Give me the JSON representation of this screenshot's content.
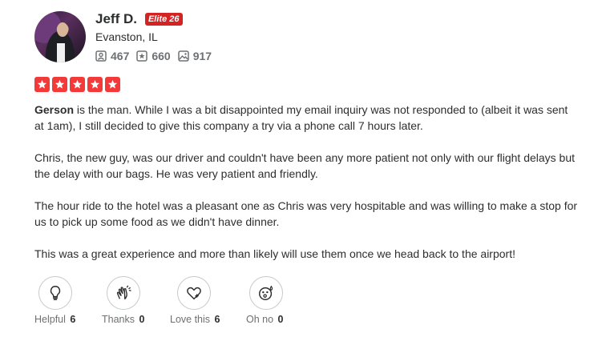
{
  "user": {
    "name": "Jeff D.",
    "elite_badge": "Elite 26",
    "location": "Evanston, IL",
    "stats": {
      "friends": "467",
      "reviews": "660",
      "photos": "917"
    }
  },
  "rating": {
    "stars": 5,
    "max": 5,
    "color": "#f43939"
  },
  "review": {
    "p1_bold": "Gerson",
    "p1_rest": " is the man. While I was a bit disappointed my email inquiry was not responded to (albeit it was sent at 1am), I still decided to give this company a try via a phone call 7 hours later.",
    "p2": "Chris, the new guy, was our driver and couldn't have been any more patient not only with our flight delays but the delay with our bags. He was very patient and friendly.",
    "p3": "The hour ride to the hotel was a pleasant one as Chris was very hospitable and was willing to make a stop for us to pick up some food as we didn't have dinner.",
    "p4": "This was a great experience and more than likely will use them once we head back to the airport!"
  },
  "reactions": [
    {
      "label": "Helpful",
      "count": "6",
      "icon": "lightbulb-icon"
    },
    {
      "label": "Thanks",
      "count": "0",
      "icon": "clapping-hands-icon"
    },
    {
      "label": "Love this",
      "count": "6",
      "icon": "heart-icon"
    },
    {
      "label": "Oh no",
      "count": "0",
      "icon": "surprised-face-icon"
    }
  ],
  "colors": {
    "elite_red": "#d32323",
    "star_red": "#f43939",
    "muted_text": "#6e7072"
  }
}
